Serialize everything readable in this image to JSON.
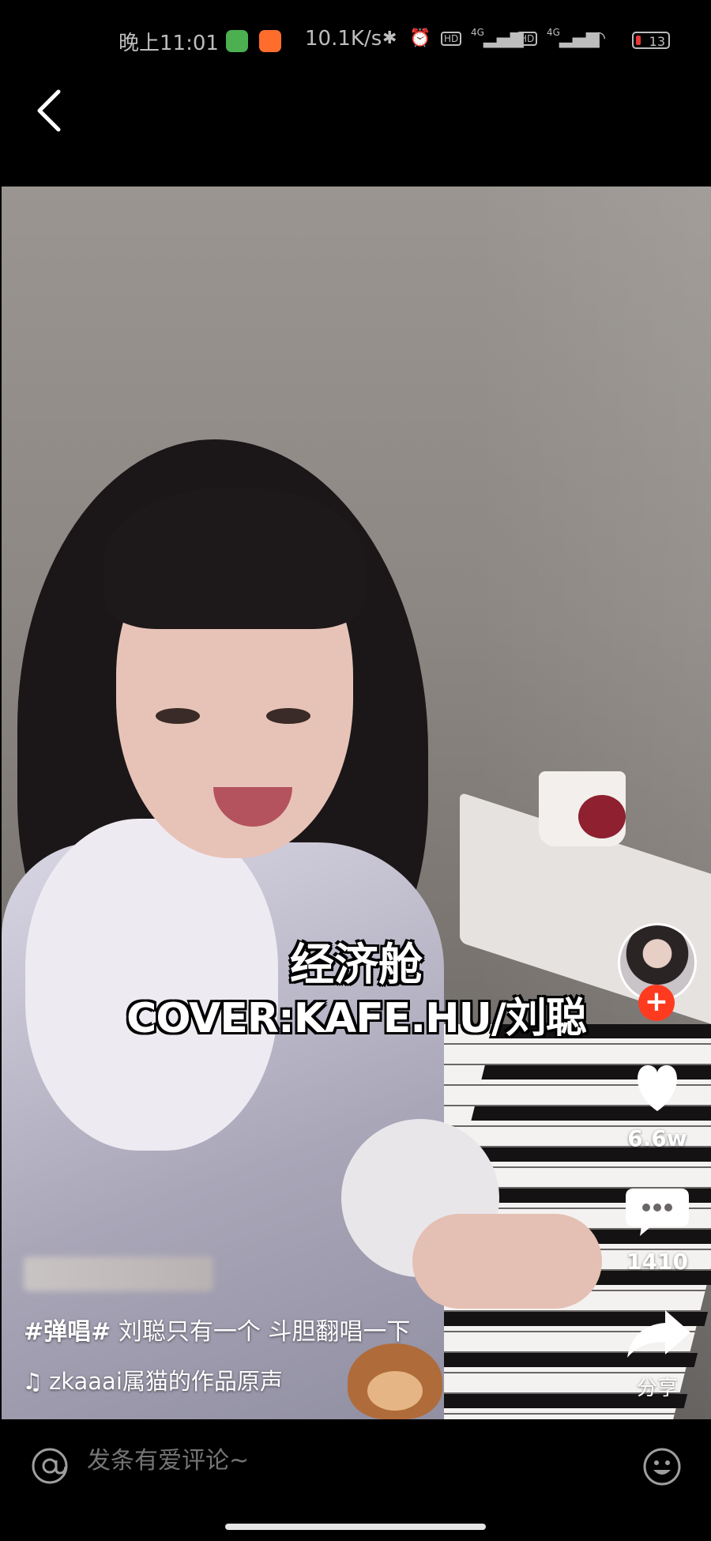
{
  "status_bar": {
    "time": "晚上11:01",
    "network_speed": "10.1K/s",
    "sim1_label": "HD",
    "sim1_network": "4G",
    "sim2_label": "HD",
    "sim2_network": "4G",
    "battery": "13",
    "icons": [
      "app-icon-green",
      "app-icon-orange",
      "bluetooth-icon",
      "alarm-icon",
      "signal-icon",
      "wifi-icon",
      "battery-icon"
    ],
    "colors": {
      "green_app": "#4caf50",
      "orange_app": "#ff6d2d",
      "battery_low": "#e53935"
    }
  },
  "header": {
    "back_icon": "chevron-left-icon"
  },
  "video": {
    "overlay_title": "经济舱",
    "overlay_subtitle": "COVER:KAFE.HU/刘聪",
    "caption_hashtag": "#弹唱#",
    "caption_text": " 刘聪只有一个 斗胆翻唱一下",
    "music_note_icon": "music-note-icon",
    "music_text": "zkaaai属猫的作品原声",
    "music_marquee": "zkaaai"
  },
  "actions": {
    "follow_icon": "plus-icon",
    "like_icon": "heart-icon",
    "like_count": "6.6w",
    "comment_icon": "comment-bubble-icon",
    "comment_count": "1410",
    "share_icon": "share-arrow-icon",
    "share_label": "分享",
    "follow_color": "#ff3b1f"
  },
  "comment_bar": {
    "at_icon": "at-icon",
    "placeholder": "发条有爱评论~",
    "emoji_icon": "emoji-icon"
  }
}
